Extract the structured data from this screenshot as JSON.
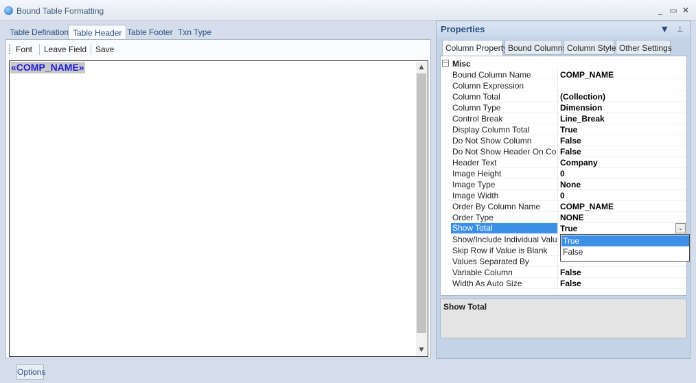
{
  "window": {
    "title": "Bound Table Formatting",
    "controls": {
      "minimize": "_",
      "restore": "▭",
      "close": "✕"
    }
  },
  "left_tabs": [
    "Table Defination",
    "Table Header",
    "Table Footer",
    "Txn Type"
  ],
  "active_left_tab": "Table Header",
  "toolbar": {
    "font": "Font",
    "leave_field": "Leave Field",
    "save": "Save"
  },
  "editor": {
    "field_text": "«COMP_NAME»"
  },
  "properties": {
    "title": "Properties",
    "header_buttons": {
      "dropdown": "▼",
      "pin": "⊥"
    },
    "tabs": [
      "Column Property",
      "Bound Columns",
      "Column Style",
      "Other Settings"
    ],
    "active_tab": "Column Property",
    "category": {
      "toggle": "−",
      "label": "Misc"
    },
    "rows": [
      {
        "name": "Bound Column Name",
        "value": "COMP_NAME"
      },
      {
        "name": "Column Expression",
        "value": ""
      },
      {
        "name": "Column Total",
        "value": "(Collection)"
      },
      {
        "name": "Column Type",
        "value": "Dimension"
      },
      {
        "name": "Control Break",
        "value": "Line_Break"
      },
      {
        "name": "Display Column Total",
        "value": "True"
      },
      {
        "name": "Do Not Show Column",
        "value": "False"
      },
      {
        "name": "Do Not Show Header On Contro",
        "value": "False"
      },
      {
        "name": "Header Text",
        "value": "Company"
      },
      {
        "name": "Image Height",
        "value": "0"
      },
      {
        "name": "Image Type",
        "value": "None"
      },
      {
        "name": "Image Width",
        "value": "0"
      },
      {
        "name": "Order By Column Name",
        "value": "COMP_NAME"
      },
      {
        "name": "Order Type",
        "value": "NONE"
      },
      {
        "name": "Show Total",
        "value": "True"
      },
      {
        "name": "Show/Include Individual Values",
        "value": ""
      },
      {
        "name": "Skip Row if Value is Blank",
        "value": ""
      },
      {
        "name": "Values Separated By",
        "value": ""
      },
      {
        "name": "Variable Column",
        "value": "False"
      },
      {
        "name": "Width As Auto Size",
        "value": "False"
      }
    ],
    "dropdown": {
      "button": "⌄",
      "options": [
        "True",
        "False"
      ],
      "highlighted": "True"
    },
    "description": {
      "title": "Show Total"
    }
  },
  "footer": {
    "options_label": "Options"
  }
}
